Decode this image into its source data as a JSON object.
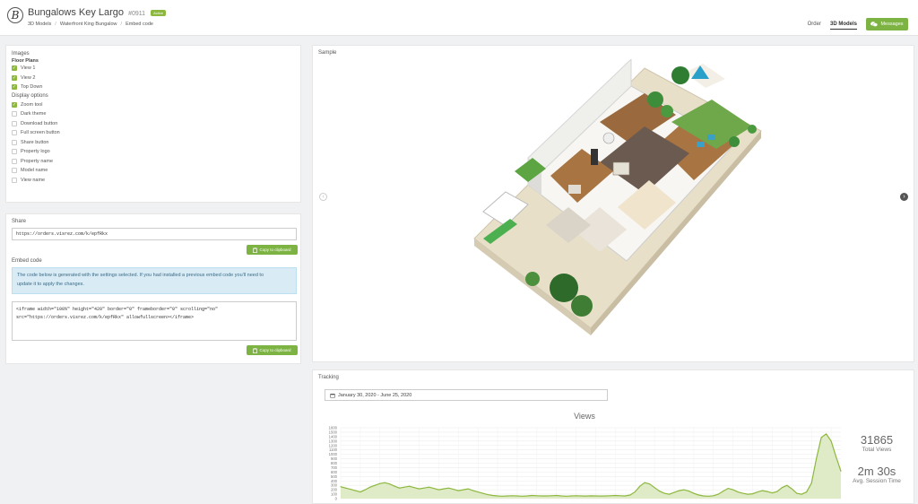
{
  "header": {
    "logo_letter": "B",
    "title": "Bungalows Key Largo",
    "code": "#0911",
    "badge": "Active",
    "breadcrumbs": [
      "3D Models",
      "Waterfront King Bungalow",
      "Embed code"
    ],
    "nav": [
      "Order",
      "3D Models"
    ],
    "active_nav": "3D Models",
    "messages_label": "Messages"
  },
  "images": {
    "title": "Images",
    "floor_plans_label": "Floor Plans",
    "items": [
      {
        "label": "View 1",
        "checked": true
      },
      {
        "label": "View 2",
        "checked": true
      },
      {
        "label": "Top Down",
        "checked": true
      }
    ]
  },
  "display": {
    "title": "Display options",
    "items": [
      {
        "label": "Zoom tool",
        "checked": true
      },
      {
        "label": "Dark theme",
        "checked": false
      },
      {
        "label": "Download button",
        "checked": false
      },
      {
        "label": "Full screen button",
        "checked": false
      },
      {
        "label": "Share button",
        "checked": false
      },
      {
        "label": "Property logo",
        "checked": false
      },
      {
        "label": "Property name",
        "checked": false
      },
      {
        "label": "Model name",
        "checked": false
      },
      {
        "label": "View name",
        "checked": false
      }
    ]
  },
  "share": {
    "title": "Share",
    "url": "https://orders.visrez.com/k/epfRkx",
    "copy_label": "Copy to clipboard"
  },
  "embed": {
    "title": "Embed code",
    "info_line1": "The code below is generated with the settings selected. If you had installed a previous embed code you'll need to",
    "info_line2": "update it to apply the changes.",
    "code_line1": "<iframe width=\"100%\" height=\"420\" border=\"0\" frameborder=\"0\" scrolling=\"no\"",
    "code_line2": "src=\"https://orders.visrez.com/k/epfRkx\" allowfullscreen></iframe>",
    "copy_label": "Copy to clipboard"
  },
  "sample": {
    "title": "Sample"
  },
  "tracking": {
    "title": "Tracking",
    "date_range": "January 30, 2020 - June 25, 2020",
    "total_views": "31865",
    "total_views_label": "Total Views",
    "session_time": "2m 30s",
    "session_time_label": "Avg. Session Time"
  },
  "colors": {
    "accent": "#7cb342",
    "line": "#8cb83e",
    "fill": "#dfeac6"
  },
  "chart_data": {
    "type": "area",
    "title": "Views",
    "ylim": [
      0,
      1600
    ],
    "yticks": [
      0,
      100,
      200,
      300,
      400,
      500,
      600,
      700,
      800,
      900,
      1000,
      1100,
      1200,
      1300,
      1400,
      1500,
      1600
    ],
    "grid": true,
    "values": [
      270,
      240,
      210,
      180,
      150,
      200,
      260,
      300,
      340,
      360,
      330,
      280,
      240,
      260,
      280,
      250,
      220,
      240,
      260,
      230,
      200,
      220,
      240,
      210,
      180,
      200,
      220,
      180,
      150,
      120,
      90,
      70,
      60,
      55,
      60,
      65,
      60,
      55,
      60,
      70,
      65,
      60,
      60,
      65,
      70,
      60,
      55,
      60,
      65,
      60,
      58,
      62,
      60,
      58,
      60,
      65,
      70,
      65,
      60,
      80,
      150,
      280,
      360,
      330,
      250,
      170,
      120,
      100,
      140,
      180,
      200,
      170,
      120,
      80,
      60,
      55,
      65,
      100,
      170,
      230,
      200,
      150,
      120,
      100,
      110,
      150,
      180,
      160,
      130,
      160,
      250,
      300,
      220,
      120,
      100,
      150,
      350,
      900,
      1380,
      1460,
      1300,
      950,
      620
    ]
  }
}
